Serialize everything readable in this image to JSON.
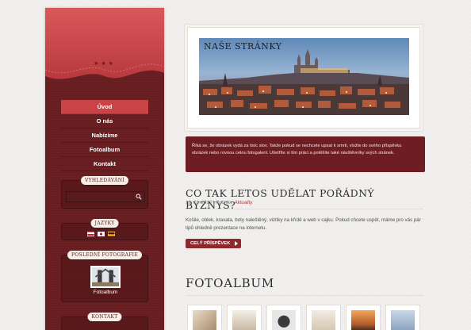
{
  "sidebar": {
    "stars": "★★★",
    "nav": [
      {
        "label": "Úvod",
        "active": true
      },
      {
        "label": "O nás",
        "active": false
      },
      {
        "label": "Nabízíme",
        "active": false
      },
      {
        "label": "Fotoalbum",
        "active": false
      },
      {
        "label": "Kontakt",
        "active": false
      }
    ],
    "search": {
      "title": "VYHLEDÁVÁNÍ",
      "value": "",
      "placeholder": ""
    },
    "languages": {
      "title": "JAZYKY"
    },
    "photos": {
      "title": "POSLEDNÍ FOTOGRAFIE",
      "caption": "Fotoalbum"
    },
    "contact": {
      "title": "KONTAKT"
    }
  },
  "banner": {
    "title": "NAŠE STRÁNKY"
  },
  "info": {
    "text": "Říká se, že obrázek vydá za tisíc slov. Takže pokud se nechcete upsat k smrti, vložte do svého příspěvku obrázek nebo rovnou celou fotogalerii. Ušetříte si tím práci a potěšíte také návštěvníky svých stránek."
  },
  "post": {
    "title": "CO TAK LETOS UDĚLAT POŘÁDNÝ BYZNYS?",
    "date": "12. 11. 2013",
    "sep": " | Rubrika: ",
    "category": "Aktuality",
    "text": "Košile, oblek, kravata, boty naleštěný, vizitky na křídě a web v cajku. Pokud chcete uspět, máme pro vás pár tipů ohledně prezentace na internetu.",
    "read_more": "CELÝ PŘÍSPĚVEK"
  },
  "gallery": {
    "title": "FOTOALBUM"
  },
  "colors": {
    "primary": "#6e1e22",
    "accent": "#c94447",
    "banner_sky": "#5c86b6"
  }
}
